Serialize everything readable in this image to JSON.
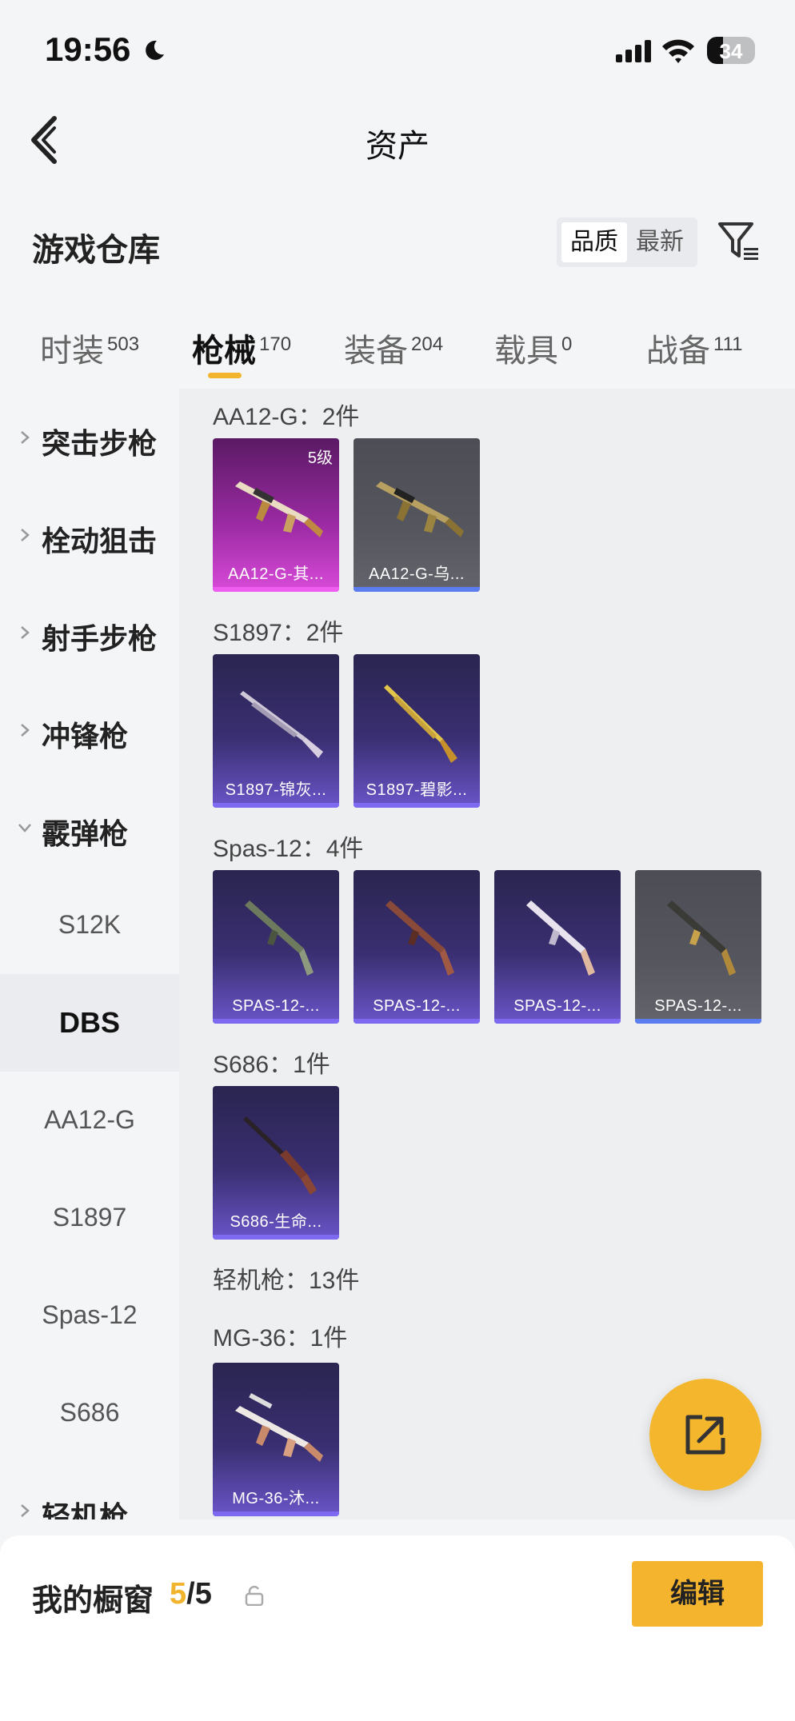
{
  "status_bar": {
    "time": "19:56",
    "battery": "34",
    "battery_level": 0.34
  },
  "header": {
    "title": "资产"
  },
  "warehouse": {
    "title": "游戏仓库",
    "sort_options": [
      "品质",
      "最新"
    ],
    "active_sort": "品质"
  },
  "tabs": [
    {
      "label": "时装",
      "count": "503"
    },
    {
      "label": "枪械",
      "count": "170"
    },
    {
      "label": "装备",
      "count": "204"
    },
    {
      "label": "载具",
      "count": "0"
    },
    {
      "label": "战备",
      "count": "111"
    }
  ],
  "active_tab": "枪械",
  "sidebar": {
    "categories": [
      "突击步枪",
      "栓动狙击",
      "射手步枪",
      "冲锋枪",
      "霰弹枪"
    ],
    "subitems": [
      "S12K",
      "DBS",
      "AA12-G",
      "S1897",
      "Spas-12",
      "S686"
    ],
    "selected": "DBS",
    "partial": "轻机枪"
  },
  "groups": [
    {
      "title": "AA12-G：2件",
      "items": [
        {
          "name": "AA12-G-其...",
          "rarity": "magenta",
          "level": "5级"
        },
        {
          "name": "AA12-G-乌...",
          "rarity": "grey"
        }
      ]
    },
    {
      "title": "S1897：2件",
      "items": [
        {
          "name": "S1897-锦灰...",
          "rarity": "purple"
        },
        {
          "name": "S1897-碧影...",
          "rarity": "purple"
        }
      ]
    },
    {
      "title": "Spas-12：4件",
      "items": [
        {
          "name": "SPAS-12-...",
          "rarity": "purple"
        },
        {
          "name": "SPAS-12-...",
          "rarity": "purple"
        },
        {
          "name": "SPAS-12-...",
          "rarity": "purple"
        },
        {
          "name": "SPAS-12-...",
          "rarity": "grey"
        }
      ]
    },
    {
      "title": "S686：1件",
      "items": [
        {
          "name": "S686-生命...",
          "rarity": "purple"
        }
      ]
    },
    {
      "title": "轻机枪：13件",
      "items": []
    },
    {
      "title": "MG-36：1件",
      "items": [
        {
          "name": "MG-36-沐...",
          "rarity": "purple"
        }
      ]
    }
  ],
  "bottom": {
    "showcase_label": "我的橱窗",
    "showcase_current": "5",
    "showcase_total": "/5",
    "edit_label": "编辑"
  },
  "colors": {
    "accent": "#f1b42c",
    "purple": "#7d6af0",
    "magenta": "#ef5cf0",
    "blue": "#5b7df0"
  }
}
